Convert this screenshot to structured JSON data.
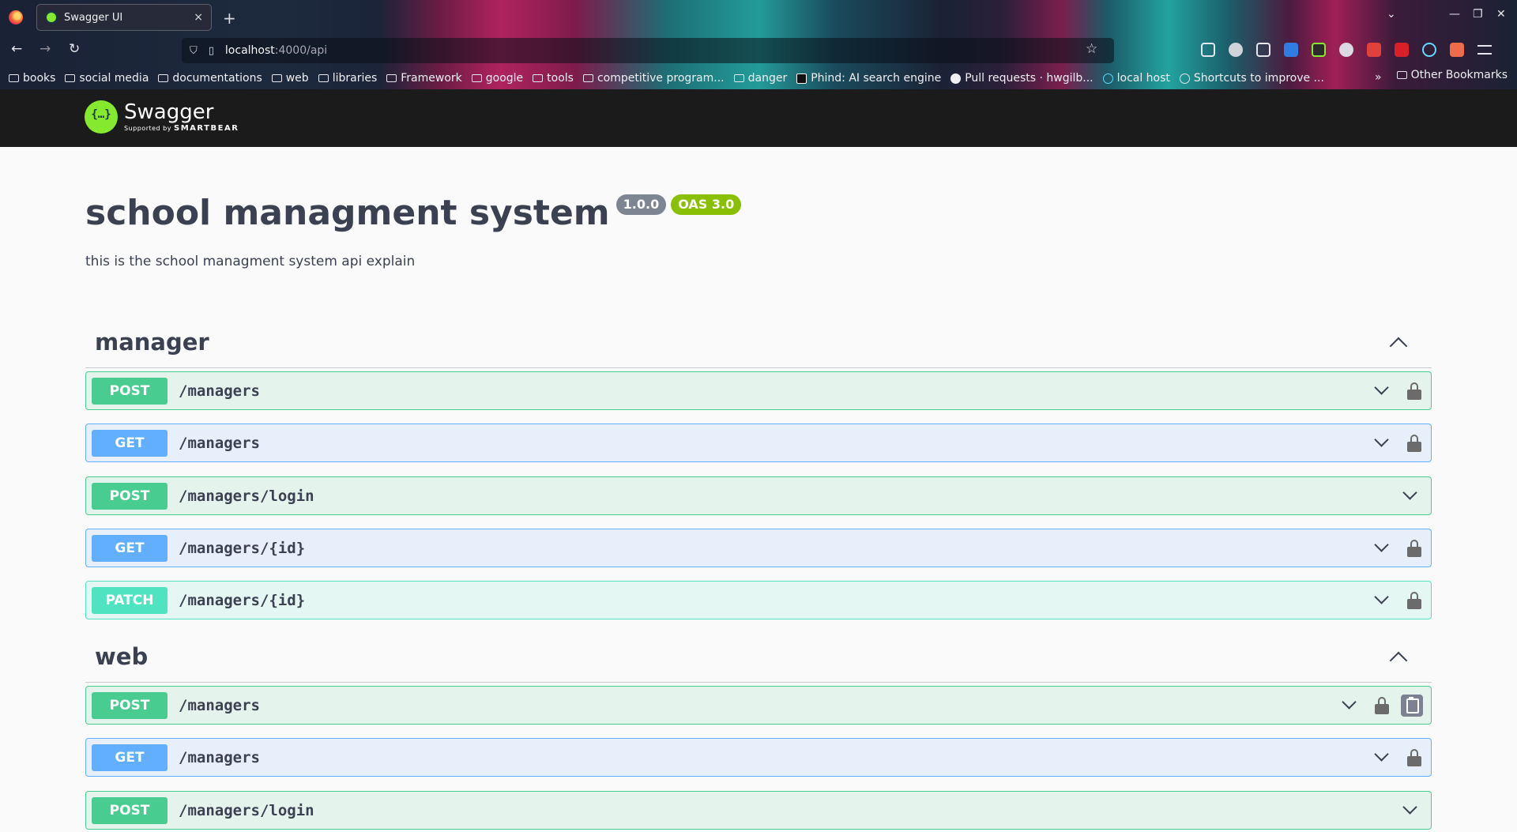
{
  "browser": {
    "tab_title": "Swagger UI",
    "tab_close": "×",
    "new_tab": "+",
    "url_host": "localhost",
    "url_path": ":4000/api",
    "bookmarks": [
      {
        "label": "books",
        "icon": "folder-icon"
      },
      {
        "label": "social media",
        "icon": "folder-icon"
      },
      {
        "label": "documentations",
        "icon": "folder-icon"
      },
      {
        "label": "web",
        "icon": "folder-icon"
      },
      {
        "label": "libraries",
        "icon": "folder-icon"
      },
      {
        "label": "Framework",
        "icon": "folder-icon"
      },
      {
        "label": "google",
        "icon": "folder-icon"
      },
      {
        "label": "tools",
        "icon": "folder-icon"
      },
      {
        "label": "competitive program...",
        "icon": "folder-icon"
      },
      {
        "label": "danger",
        "icon": "folder-icon"
      },
      {
        "label": "Phind: AI search engine",
        "icon": "phind-icon"
      },
      {
        "label": "Pull requests · hwgilb...",
        "icon": "github-icon"
      },
      {
        "label": "local host",
        "icon": "react-icon"
      },
      {
        "label": "Shortcuts to improve ...",
        "icon": "globe-icon"
      }
    ],
    "other_bookmarks": "Other Bookmarks"
  },
  "swagger": {
    "logo_name": "Swagger",
    "logo_sub_prefix": "Supported by",
    "logo_sub_brand": "SMARTBEAR"
  },
  "info": {
    "title": "school managment system",
    "version": "1.0.0",
    "oas": "OAS 3.0",
    "description": "this is the school managment system api explain"
  },
  "tags": [
    {
      "name": "manager",
      "operations": [
        {
          "method": "POST",
          "path": "/managers",
          "locked": true
        },
        {
          "method": "GET",
          "path": "/managers",
          "locked": true
        },
        {
          "method": "POST",
          "path": "/managers/login",
          "locked": false
        },
        {
          "method": "GET",
          "path": "/managers/{id}",
          "locked": true
        },
        {
          "method": "PATCH",
          "path": "/managers/{id}",
          "locked": true
        }
      ]
    },
    {
      "name": "web",
      "operations": [
        {
          "method": "POST",
          "path": "/managers",
          "locked": true,
          "copy": true
        },
        {
          "method": "GET",
          "path": "/managers",
          "locked": true
        },
        {
          "method": "POST",
          "path": "/managers/login",
          "locked": false
        }
      ]
    }
  ],
  "colors": {
    "post": "#49cc90",
    "get": "#61affe",
    "patch": "#50e3c2",
    "topbar": "#1b1b1b",
    "swagger_green": "#85ea2d",
    "oas_badge": "#89bf04"
  }
}
